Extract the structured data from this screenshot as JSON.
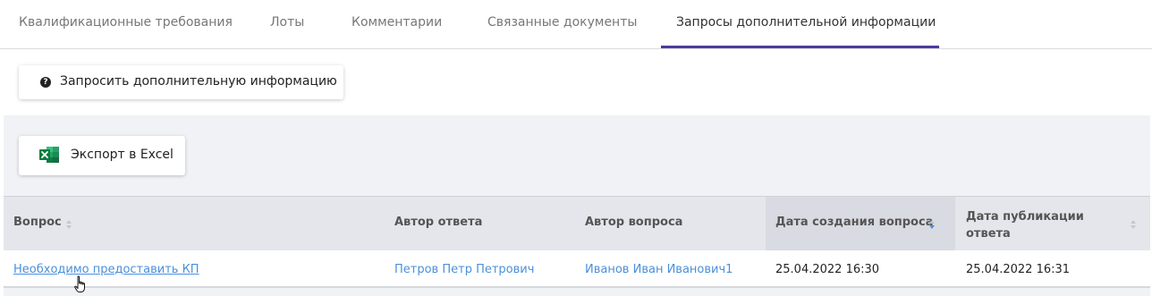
{
  "tabs": [
    {
      "label": "Квалификационные требования"
    },
    {
      "label": "Лоты"
    },
    {
      "label": "Комментарии"
    },
    {
      "label": "Связанные документы"
    },
    {
      "label": "Запросы дополнительной информации"
    }
  ],
  "active_tab": "Запросы дополнительной информации",
  "request_button": {
    "label": "Запросить дополнительную информацию",
    "icon": "question-circle-icon"
  },
  "excel_button": {
    "label": "Экспорт в Excel",
    "icon": "excel-icon"
  },
  "table": {
    "columns": [
      {
        "label": "Вопрос",
        "sortable": true
      },
      {
        "label": "Автор ответа",
        "sortable": false
      },
      {
        "label": "Автор вопроса",
        "sortable": false
      },
      {
        "label": "Дата создания вопроса",
        "sortable": true,
        "sort": "desc"
      },
      {
        "label": "Дата публикации ответа",
        "sortable": true
      }
    ],
    "rows": [
      {
        "question": "Необходимо предоставить КП",
        "answer_author": "Петров Петр Петрович",
        "question_author": "Иванов Иван Иванович1",
        "created": "25.04.2022 16:30",
        "published": "25.04.2022 16:31"
      }
    ]
  },
  "colors": {
    "accent": "#4b3a9e",
    "link": "#4a90d9",
    "panel": "#f0f2f5",
    "header": "#e4e6eb",
    "excel_green": "#1e7145"
  }
}
